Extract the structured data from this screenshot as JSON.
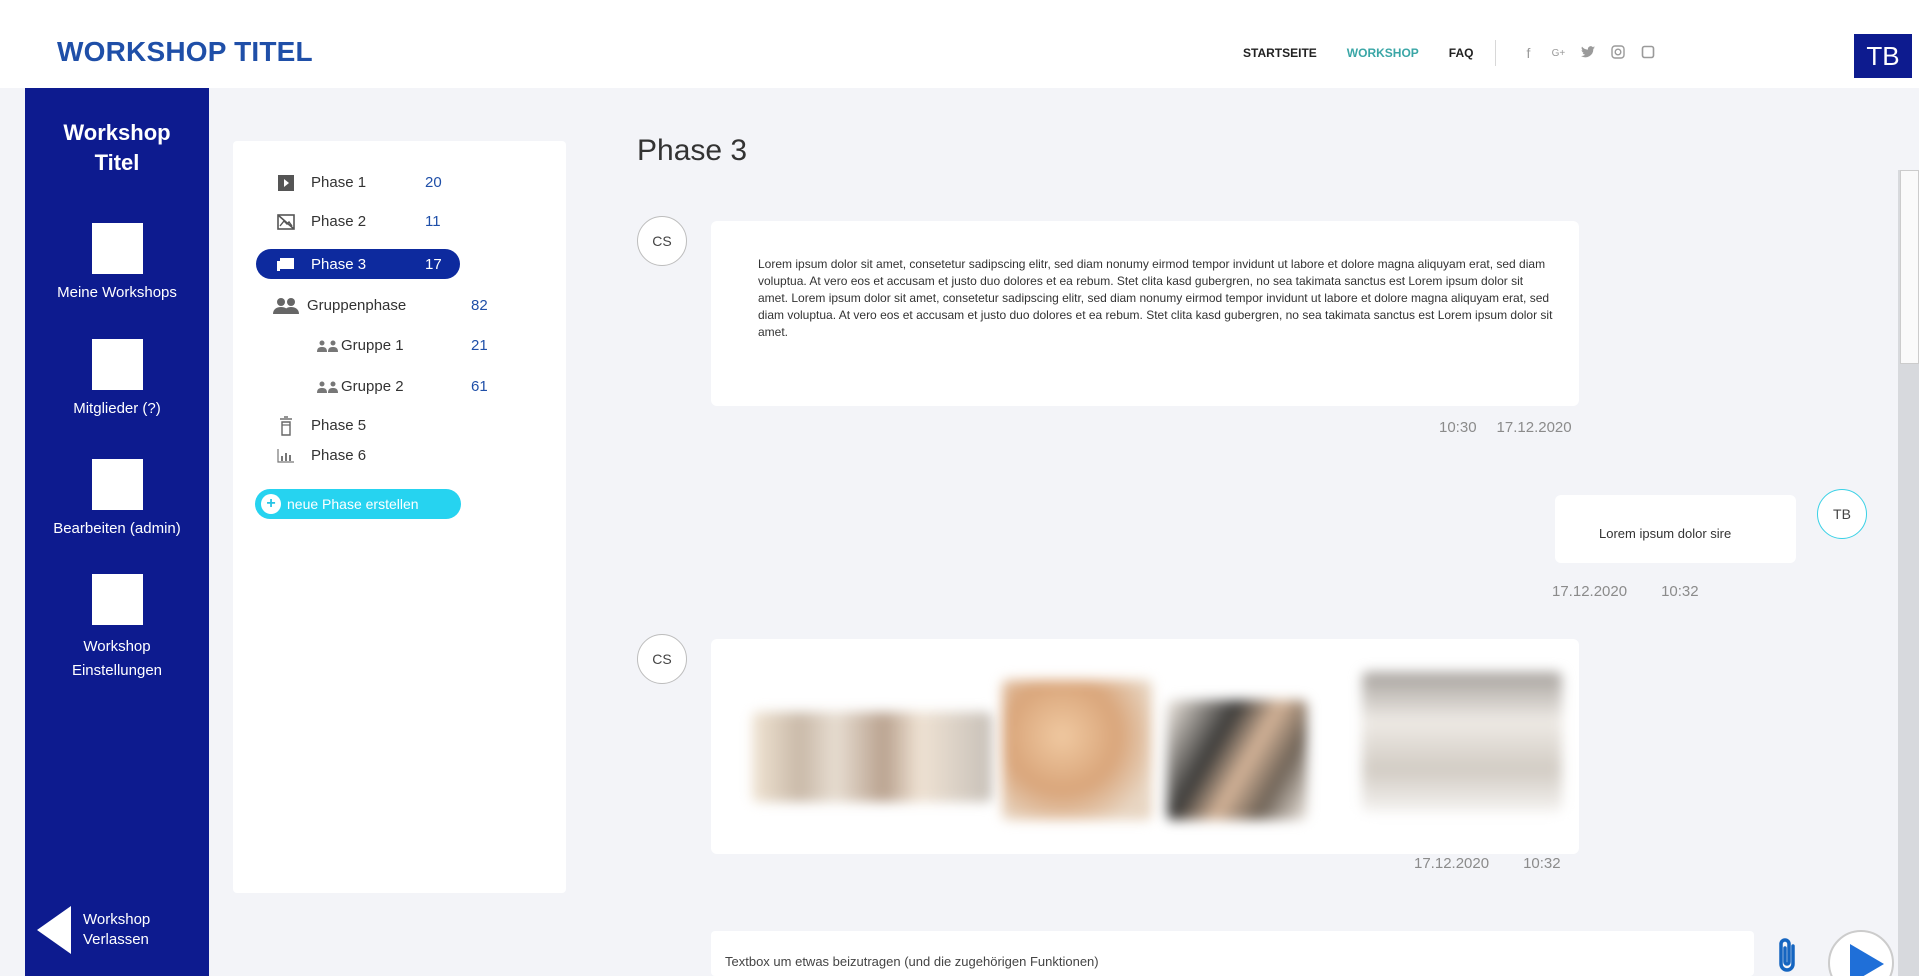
{
  "header": {
    "brand": "WORKSHOP TITEL",
    "nav": [
      {
        "label": "STARTSEITE",
        "active": false
      },
      {
        "label": "WORKSHOP",
        "active": true
      },
      {
        "label": "FAQ",
        "active": false
      }
    ],
    "social_icons": [
      "facebook-icon",
      "google-plus-icon",
      "twitter-icon",
      "instagram-icon",
      "square-icon"
    ],
    "user_initials": "TB"
  },
  "sidebar": {
    "title_line1": "Workshop",
    "title_line2": "Titel",
    "items": [
      {
        "label": "Meine Workshops"
      },
      {
        "label": "Mitglieder (?)"
      },
      {
        "label": "Bearbeiten (admin)"
      },
      {
        "label": "Workshop Einstellungen"
      }
    ],
    "leave_line1": "Workshop",
    "leave_line2": "Verlassen"
  },
  "phases": {
    "items": [
      {
        "label": "Phase 1",
        "count": "20",
        "icon": "play-icon"
      },
      {
        "label": "Phase 2",
        "count": "11",
        "icon": "no-image-icon"
      },
      {
        "label": "Phase 3",
        "count": "17",
        "icon": "chat-icon",
        "active": true
      },
      {
        "label": "Gruppenphase",
        "count": "82",
        "icon": "group-icon"
      },
      {
        "label": "Gruppe 1",
        "count": "21",
        "icon": "people-icon"
      },
      {
        "label": "Gruppe 2",
        "count": "61",
        "icon": "people-icon"
      },
      {
        "label": "Phase 5",
        "count": "",
        "icon": "trash-icon"
      },
      {
        "label": "Phase 6",
        "count": "",
        "icon": "bar-chart-icon"
      }
    ],
    "new_phase_label": "neue Phase erstellen"
  },
  "chat": {
    "title": "Phase 3",
    "messages": [
      {
        "author": "CS",
        "text": "Lorem ipsum dolor sit amet, consetetur sadipscing elitr, sed diam nonumy eirmod tempor invidunt ut labore et dolore magna aliquyam erat, sed diam voluptua. At vero eos et accusam et justo duo dolores et ea rebum. Stet clita kasd gubergren, no sea takimata sanctus est Lorem ipsum dolor sit amet. Lorem ipsum dolor sit amet, consetetur sadipscing elitr, sed diam nonumy eirmod tempor invidunt ut labore et dolore magna aliquyam erat, sed diam voluptua. At vero eos et accusam et justo duo dolores et ea rebum. Stet clita kasd gubergren, no sea takimata sanctus est Lorem ipsum dolor sit amet.",
        "time": "10:30",
        "date": "17.12.2020"
      },
      {
        "author": "TB",
        "text": "Lorem ipsum dolor sire",
        "date": "17.12.2020",
        "time": "10:32"
      },
      {
        "author": "CS",
        "text": "",
        "date": "17.12.2020",
        "time": "10:32"
      }
    ],
    "input_placeholder": "Textbox um etwas  beizutragen (und die zugehörigen Funktionen)"
  }
}
